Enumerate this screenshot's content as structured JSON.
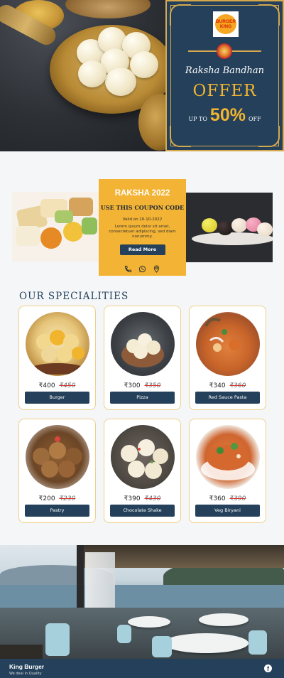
{
  "hero": {
    "brand_logo_line1": "BURGER",
    "brand_logo_line2": "KING",
    "festival": "Raksha Bandhan",
    "offer": "OFFER",
    "upto": "UP TO",
    "discount": "50%",
    "off": "OFF"
  },
  "coupon": {
    "title": "RAKSHA 2022",
    "subtitle": "USE THIS COUPON CODE",
    "valid": "Valid on 10-10-2022",
    "description": "Lorem ipsum dolor sit amet, consectetuer adipiscing, sed diam nonummy.",
    "read_more": "Read More",
    "icons": [
      "phone-icon",
      "whatsapp-icon",
      "location-pin-icon"
    ]
  },
  "specialities": {
    "heading": "OUR SPECIALITIES",
    "items": [
      {
        "name": "Burger",
        "price": "₹400",
        "old_price": "₹450"
      },
      {
        "name": "Pizza",
        "price": "₹300",
        "old_price": "₹350"
      },
      {
        "name": "Red Sauce Pasta",
        "price": "₹340",
        "old_price": "₹360"
      },
      {
        "name": "Pastry",
        "price": "₹200",
        "old_price": "₹230"
      },
      {
        "name": "Chocolate Shake",
        "price": "₹390",
        "old_price": "₹430"
      },
      {
        "name": "Veg Biryani",
        "price": "₹360",
        "old_price": "₹390"
      }
    ]
  },
  "footer": {
    "brand": "King Burger",
    "tagline": "We deal in Quality",
    "social_icon": "facebook-icon"
  },
  "colors": {
    "navy": "#24405a",
    "gold": "#f3b334",
    "accent_gold": "#d7a94e"
  }
}
